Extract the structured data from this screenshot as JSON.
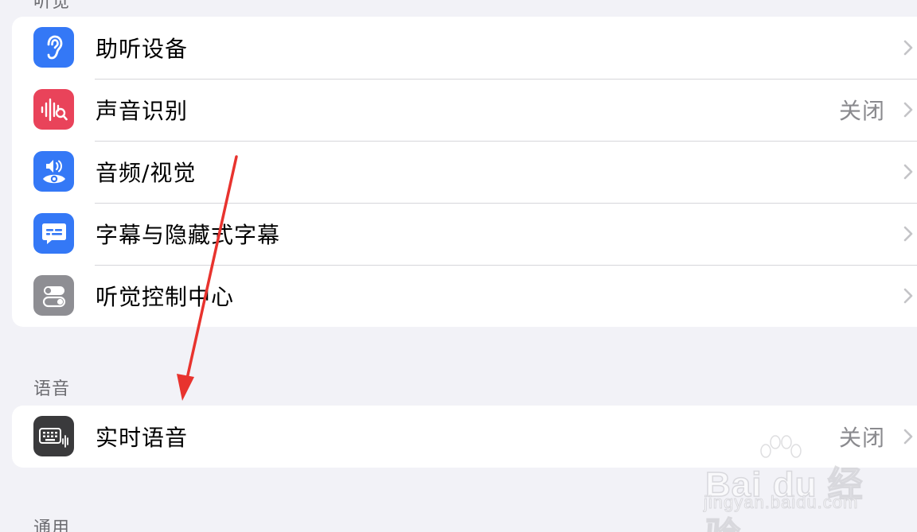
{
  "sections": {
    "hearing_header": "听觉",
    "speech_header": "语音",
    "general_header": "通用"
  },
  "hearing_items": [
    {
      "label": "助听设备",
      "value": "",
      "icon": "ear-icon",
      "color": "#3478f6"
    },
    {
      "label": "声音识别",
      "value": "关闭",
      "icon": "sound-recognition-icon",
      "color": "#e9435a"
    },
    {
      "label": "音频/视觉",
      "value": "",
      "icon": "audio-visual-icon",
      "color": "#3478f6"
    },
    {
      "label": "字幕与隐藏式字幕",
      "value": "",
      "icon": "captions-icon",
      "color": "#3478f6"
    },
    {
      "label": "听觉控制中心",
      "value": "",
      "icon": "toggles-icon",
      "color": "#8e8e93"
    }
  ],
  "speech_items": [
    {
      "label": "实时语音",
      "value": "关闭",
      "icon": "keyboard-waveform-icon",
      "color": "#3a3a3c"
    }
  ],
  "annotation": {
    "arrow_color": "#e8332e"
  },
  "watermark": {
    "brand": "Bai du 经验",
    "url": "jingyan.baidu.com"
  }
}
